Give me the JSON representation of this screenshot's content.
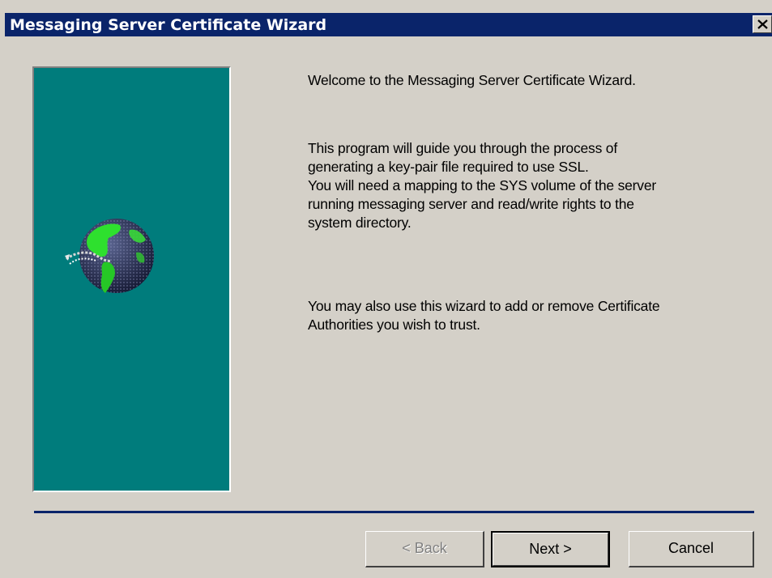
{
  "window": {
    "title": "Messaging Server Certificate Wizard"
  },
  "content": {
    "welcome": "Welcome to the Messaging Server Certificate Wizard.",
    "intro": "This program will guide you through the process of\ngenerating a key-pair file required to use SSL.\nYou will need a mapping to the SYS volume of the server\nrunning messaging server and read/write rights to the\nsystem directory.",
    "ca_text": "You may also use this wizard to add or remove Certificate\nAuthorities you wish to trust."
  },
  "buttons": {
    "back": "< Back",
    "next": "Next >",
    "cancel": "Cancel"
  },
  "icons": {
    "close": "close-icon",
    "globe": "globe-icon"
  },
  "colors": {
    "titlebar": "#0a246a",
    "side_panel": "#007c7c",
    "dialog_bg": "#d4d0c8"
  }
}
